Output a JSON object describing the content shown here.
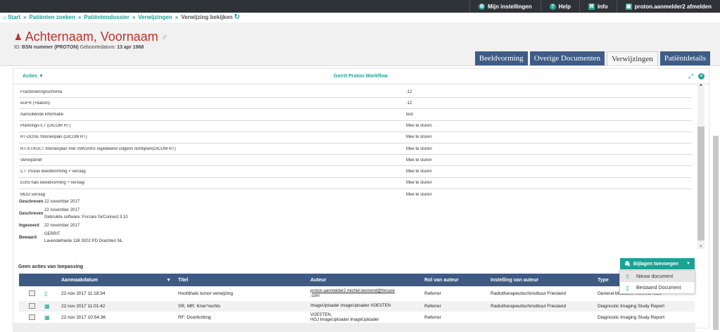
{
  "topbar": {
    "settings": "Mijn instellingen",
    "help": "Help",
    "info": "Info",
    "user": "proton.aanmelder2 afmelden"
  },
  "breadcrumb": {
    "start": "Start",
    "zoeken": "Patiënten zoeken",
    "dossier": "Patiëntendossier",
    "verwijzingen": "Verwijzingen",
    "current": "Verwijzing bekijken",
    "sep": "»"
  },
  "patient": {
    "name": "Achternaam, Voornaam",
    "gender_symbol": "♂",
    "id_label": "ID:",
    "id_value": "BSN nummer (PROTON)",
    "dob_label": "Geboortedatum:",
    "dob_value": "13 apr 1968"
  },
  "tabs": [
    "Beeldvorming",
    "Overige Documenten",
    "Verwijzingen",
    "Patiëntdetails"
  ],
  "panel": {
    "acties": "Acties",
    "workflow": "Gerrit Proton Workflow",
    "rows": [
      {
        "k": "Fractioneringsschema",
        "v": ":12"
      },
      {
        "k": "eGFR (+datum)",
        "v": ":12"
      },
      {
        "k": "Aanvullende informatie",
        "v": "test"
      },
      {
        "k": "Plannings-CT (DICOM RT)",
        "v": "Mee te sturen"
      },
      {
        "k": "RT-DOSE fotonenplan (DICOM RT)",
        "v": "Mee te sturen"
      },
      {
        "k": "RT-STRUCT fotonenplan met SWOARS ingetekend volgens richtlijnen(DICOM RT)",
        "v": "Mee te sturen"
      },
      {
        "k": "Verwijsbrief",
        "v": "Mee te sturen"
      },
      {
        "k": "CT Thorax Beeldvorming + verslag",
        "v": "Mee te sturen"
      },
      {
        "k": "Echo hals Beeldvorming + verslag",
        "v": "Mee te sturen"
      },
      {
        "k": "MDO verslag",
        "v": "Mee te sturen"
      }
    ],
    "meta": {
      "geschreven1_label": "Geschreven",
      "geschreven1_value": "22 november 2017",
      "geschreven2_label": "Geschreven",
      "geschreven2_line1": "22 november 2017",
      "geschreven2_line2": "Gebruikte software: Forcare forConnect 3.10",
      "ingevoerd_label": "Ingevoerd",
      "ingevoerd_value": "22 november 2017",
      "bewaard_label": "Bewaard",
      "bewaard_line1": "GERRIT",
      "bewaard_line2": "Lavendelheide 11B 9202 PD Drachten NL"
    }
  },
  "attachments": {
    "no_actions": "Geen acties van toepassing",
    "add_button": "Bijlagen toevoegen",
    "menu": [
      "Nieuw document",
      "Bestaand Document"
    ],
    "headers": {
      "date": "Aanmaakdatum",
      "title": "Titel",
      "author": "Auteur",
      "role": "Rol van auteur",
      "inst": "Instelling van auteur",
      "type": "Type"
    },
    "rows": [
      {
        "date": "22 nov 2017 11:18:34",
        "title": "Hoofdhals tumor verwijzing",
        "author1": "proton.aanmelder2  michiel.lexmond@forcare",
        "author2": ".com",
        "role": "Referrer",
        "inst": "Radiotherapeutischinstituut Friesland",
        "type": "General Medicine Referral Note"
      },
      {
        "date": "22 nov 2017 11:01:42",
        "title": "SR, MR: Knie^rechts",
        "author1": "ImageUploader  ImageUploader  VOESTEN",
        "author2": "",
        "role": "Referrer",
        "inst": "Radiotherapeutischinstituut Friesland",
        "type": "Diagnostic Imaging Study Report"
      },
      {
        "date": "22 nov 2017 10:54:36",
        "title": "RF: Doorlichting",
        "author1": "VOESTEN,",
        "author2": "HGJ  ImageUploader  ImageUploader",
        "role": "Referrer",
        "inst": "",
        "type": "Diagnostic Imaging Study Report"
      }
    ]
  }
}
